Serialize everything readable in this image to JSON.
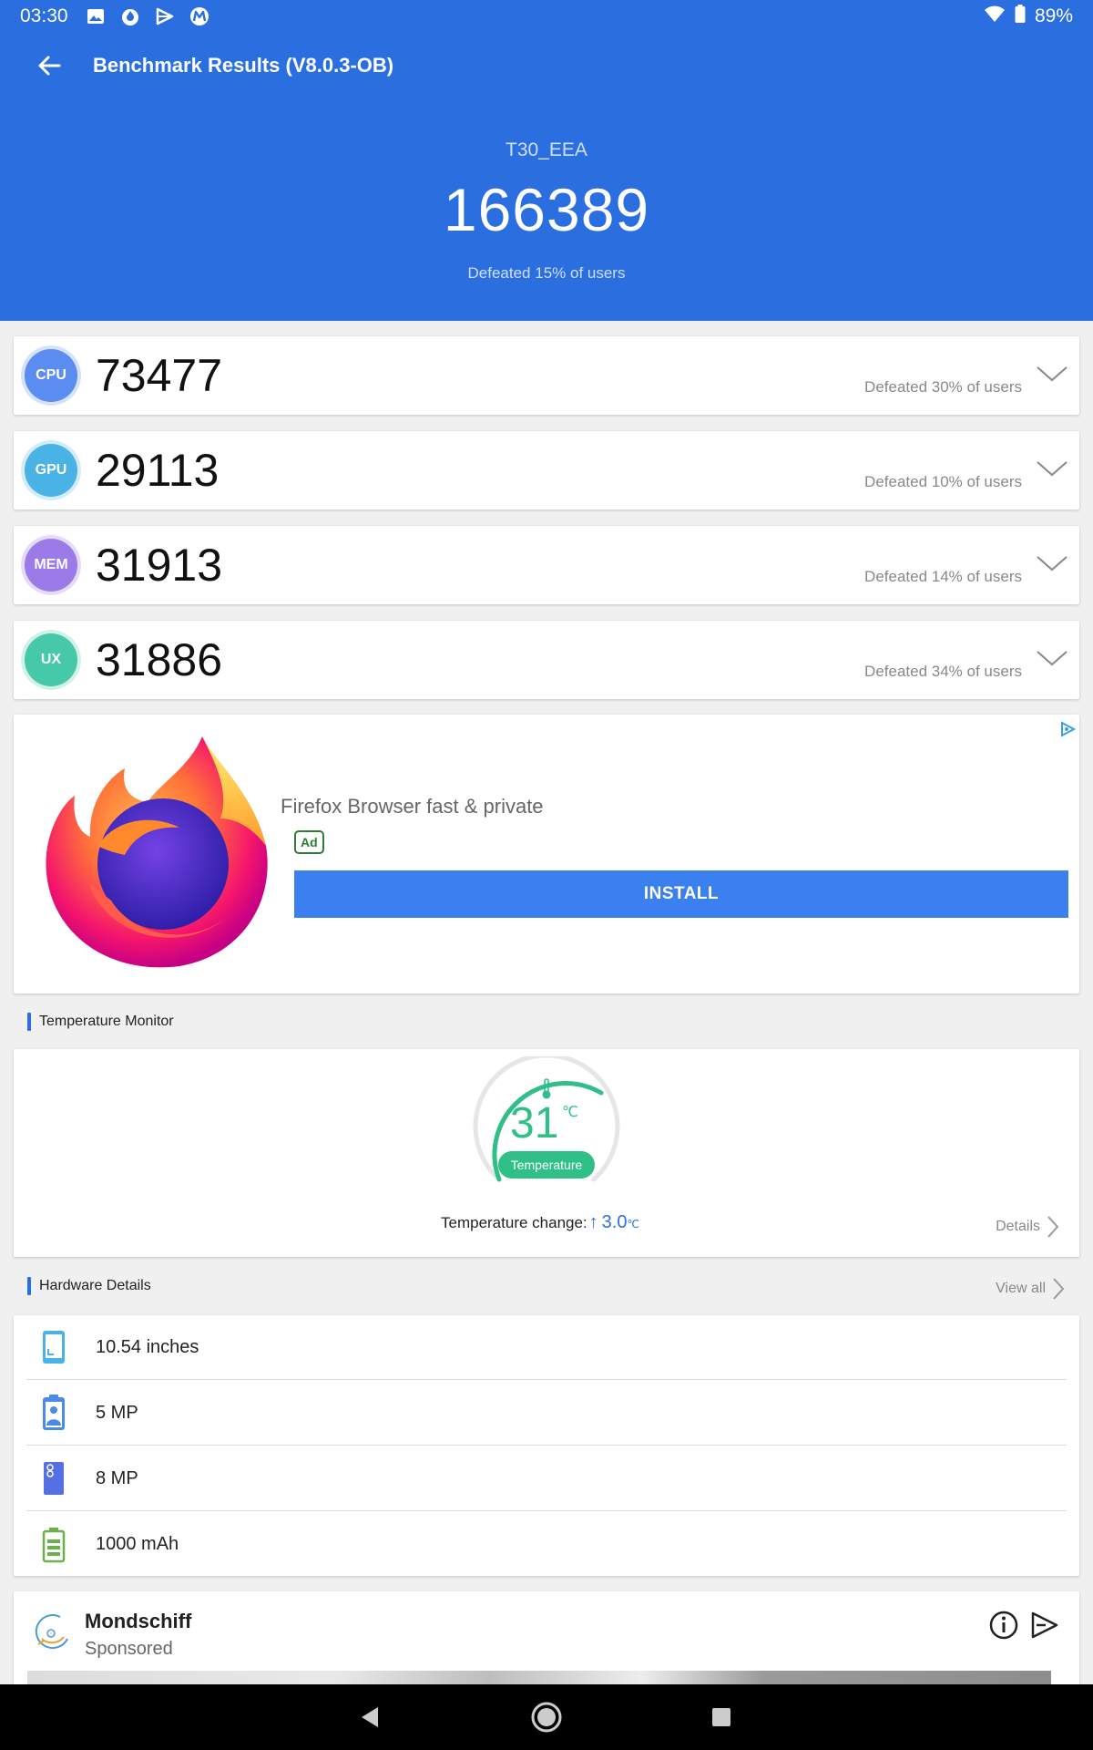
{
  "status_bar": {
    "time": "03:30",
    "battery": "89%"
  },
  "app_bar": {
    "title": "Benchmark Results (V8.0.3-OB)"
  },
  "summary": {
    "device": "T30_EEA",
    "total_score": "166389",
    "defeated": "Defeated 15% of users"
  },
  "scores": [
    {
      "badge": "CPU",
      "value": "73477",
      "defeated": "Defeated 30% of users",
      "color": "#5b8cf0"
    },
    {
      "badge": "GPU",
      "value": "29113",
      "defeated": "Defeated 10% of users",
      "color": "#4ab3e6"
    },
    {
      "badge": "MEM",
      "value": "31913",
      "defeated": "Defeated 14% of users",
      "color": "#9b7be8"
    },
    {
      "badge": "UX",
      "value": "31886",
      "defeated": "Defeated 34% of users",
      "color": "#46c9a8"
    }
  ],
  "ad": {
    "title": "Firefox Browser fast & private",
    "badge": "Ad",
    "install_label": "INSTALL"
  },
  "temperature": {
    "section_title": "Temperature Monitor",
    "value": "31",
    "unit": "℃",
    "pill": "Temperature",
    "change_label": "Temperature change:",
    "change_arrow": "↑",
    "change_value": "3.0",
    "change_unit": "℃",
    "details": "Details"
  },
  "hardware": {
    "section_title": "Hardware Details",
    "view_all": "View all",
    "items": [
      {
        "icon": "screen-icon",
        "text": "10.54 inches"
      },
      {
        "icon": "front-camera-icon",
        "text": "5 MP"
      },
      {
        "icon": "rear-camera-icon",
        "text": "8 MP"
      },
      {
        "icon": "battery-icon",
        "text": "1000 mAh"
      }
    ]
  },
  "sponsor": {
    "title": "Mondschiff",
    "subtitle": "Sponsored"
  },
  "colors": {
    "header_blue": "#2a6ee0",
    "temp_green": "#2fbf87",
    "install_blue": "#3b80ef"
  }
}
